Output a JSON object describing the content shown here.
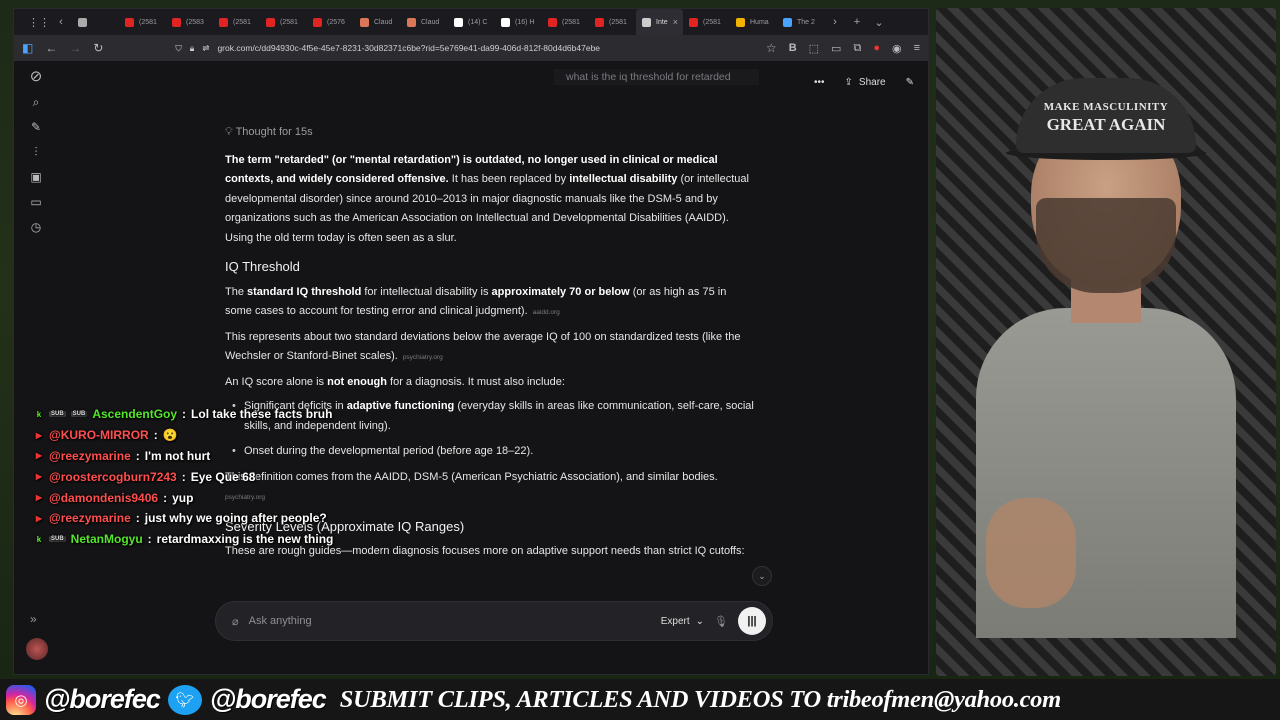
{
  "browser": {
    "tabs": [
      {
        "label": "",
        "color": "#aaaaaa"
      },
      {
        "label": "(2581",
        "color": "#e02424"
      },
      {
        "label": "(2583",
        "color": "#e02424"
      },
      {
        "label": "(2581",
        "color": "#e02424"
      },
      {
        "label": "(2581",
        "color": "#e02424"
      },
      {
        "label": "(2576",
        "color": "#e02424"
      },
      {
        "label": "Claud",
        "color": "#d97757"
      },
      {
        "label": "Claud",
        "color": "#d97757"
      },
      {
        "label": "(14) C",
        "color": "#ffffff"
      },
      {
        "label": "(16) H",
        "color": "#ffffff"
      },
      {
        "label": "(2581",
        "color": "#e02424"
      },
      {
        "label": "(2581",
        "color": "#e02424"
      },
      {
        "label": "Inte",
        "color": "#cccccc",
        "active": true
      },
      {
        "label": "(2581",
        "color": "#e02424"
      },
      {
        "label": "Huma",
        "color": "#f0b400"
      },
      {
        "label": "The 2",
        "color": "#4aa3ff"
      }
    ],
    "url": "grok.com/c/dd94930c-4f5e-45e7-8231-30d82371c6be?rid=5e769e41-da99-406d-812f-80d4d6b47ebe"
  },
  "page": {
    "top_query": "what is the iq threshold for retarded",
    "share_label": "Share",
    "thought_label": "Thought for 15s",
    "intro_bold": "The term \"retarded\" (or \"mental retardation\") is outdated, no longer used in clinical or medical contexts, and widely considered offensive.",
    "intro_rest_1": " It has been replaced by ",
    "intro_bold_2": "intellectual disability",
    "intro_rest_2": " (or intellectual developmental disorder) since around 2010–2013 in major diagnostic manuals like the DSM-5 and by organizations such as the American Association on Intellectual and Developmental Disabilities (AAIDD). Using the old term today is often seen as a slur.",
    "heading_threshold": "IQ Threshold",
    "p1_a": "The ",
    "p1_b": "standard IQ threshold",
    "p1_c": " for intellectual disability is ",
    "p1_d": "approximately 70 or below",
    "p1_e": " (or as high as 75 in some cases to account for testing error and clinical judgment).",
    "p1_src": "aaidd.org",
    "p2": "This represents about two standard deviations below the average IQ of 100 on standardized tests (like the Wechsler or Stanford-Binet scales).",
    "p2_src": "psychiatry.org",
    "p3_a": "An IQ score alone is ",
    "p3_b": "not enough",
    "p3_c": " for a diagnosis. It must also include:",
    "li1_a": "Significant deficits in ",
    "li1_b": "adaptive functioning",
    "li1_c": " (everyday skills in areas like communication, self-care, social skills, and independent living).",
    "li2": "Onset during the developmental period (before age 18–22).",
    "p4": "This definition comes from the AAIDD, DSM-5 (American Psychiatric Association), and similar bodies.",
    "p4_src": "psychiatry.org",
    "heading_ranges": "Severity Levels (Approximate IQ Ranges)",
    "p5": "These are rough guides—modern diagnosis focuses more on adaptive support needs than strict IQ cutoffs:",
    "composer_placeholder": "Ask anything",
    "mode_label": "Expert"
  },
  "chat": [
    {
      "platform": "kick",
      "badges": [
        "SUB",
        "SUB"
      ],
      "name": "AscendentGoy",
      "text": "Lol take these facts bruh"
    },
    {
      "platform": "youtube",
      "badges": [],
      "name": "@KURO-MIRROR",
      "text": "😮"
    },
    {
      "platform": "youtube",
      "badges": [],
      "name": "@reezymarine",
      "text": "I'm not hurt"
    },
    {
      "platform": "youtube",
      "badges": [],
      "name": "@roostercogburn7243",
      "text": "Eye Que 68"
    },
    {
      "platform": "youtube",
      "badges": [],
      "name": "@damondenis9406",
      "text": "yup"
    },
    {
      "platform": "youtube",
      "badges": [],
      "name": "@reezymarine",
      "text": "just why we going after people?"
    },
    {
      "platform": "kick",
      "badges": [
        "SUB"
      ],
      "name": "NetanMogyu",
      "text": "retardmaxxing is the new thing"
    }
  ],
  "webcam": {
    "cap_line1": "MAKE MASCULINITY",
    "cap_line2": "GREAT AGAIN"
  },
  "banner": {
    "instagram_handle": "@borefec",
    "twitter_handle": "@borefec",
    "submit_text": "SUBMIT CLIPS, ARTICLES AND VIDEOS TO tribeofmen@yahoo.com"
  }
}
